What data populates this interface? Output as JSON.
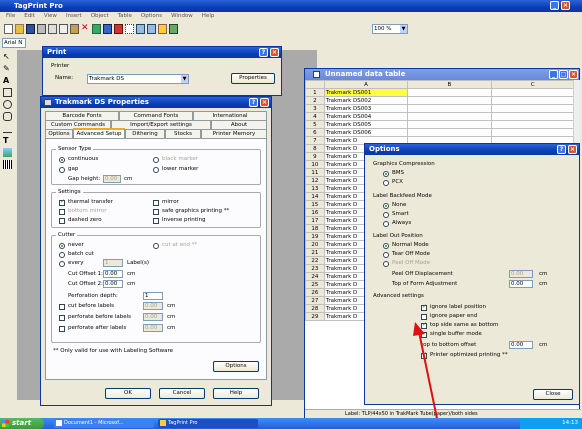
{
  "app": {
    "title": "TagPrint Pro",
    "menu": [
      "File",
      "Edit",
      "View",
      "Insert",
      "Object",
      "Table",
      "Options",
      "Window",
      "Help"
    ],
    "zoom": "100 %",
    "font": "Arial N",
    "tools_left": [
      "select-icon",
      "pencil-icon",
      "text-tool-icon",
      "rectangle-icon",
      "ellipse-icon",
      "rounded-rect-icon",
      "line-icon",
      "text-icon",
      "image-icon",
      "barcode-icon"
    ]
  },
  "print_dialog": {
    "title": "Print",
    "printer_label": "Printer",
    "name_label": "Name:",
    "name_value": "Trakmark DS",
    "properties_button": "Properties"
  },
  "props_dialog": {
    "title": "Trakmark DS Properties",
    "tabs_row1": [
      "Barcode Fonts",
      "Command Fonts",
      "International"
    ],
    "tabs_row2": [
      "Custom Commands",
      "Import/Export settings",
      "About"
    ],
    "tabs_row3": [
      "Options",
      "Advanced Setup",
      "Dithering",
      "Stocks",
      "Printer Memory"
    ],
    "sensor_type": {
      "label": "Sensor Type",
      "continuous": "continuous",
      "gap": "gap",
      "gap_height_label": "Gap height:",
      "gap_height_value": "0.00",
      "gap_height_unit": "cm",
      "black_marker": "black marker",
      "lower_marker": "lower marker"
    },
    "settings": {
      "label": "Settings",
      "thermal_transfer": "thermal transfer",
      "mirror": "mirror",
      "bottom_mirror": "bottom mirror",
      "safe_graphics": "safe graphics printing **",
      "dashed_zero": "dashed zero",
      "inverse_printing": "Inverse printing"
    },
    "cutter": {
      "label": "Cutter",
      "never": "never",
      "cut_at_end": "cut at end **",
      "batch_cut": "batch cut",
      "every": "every",
      "every_value": "1",
      "labels": "Label(s)",
      "cut_offset1_label": "Cut Offset 1:",
      "cut_offset1_value": "0.00",
      "cut_offset2_label": "Cut Offset 2:",
      "cut_offset2_value": "0.00",
      "unit": "cm",
      "perforation_depth_label": "Perforation depth:",
      "perforation_depth_value": "1",
      "cut_before": "cut before labels",
      "perforate_before": "perforate before labels",
      "perforate_after": "perforate after labels",
      "zero": "0.00"
    },
    "note": "** Only valid for use with Labeling Software",
    "options_button": "Options",
    "ok": "OK",
    "cancel": "Cancel",
    "help": "Help"
  },
  "data_table": {
    "title": "Unnamed data table",
    "columns": [
      "A",
      "B",
      "C"
    ],
    "rows": [
      {
        "n": "1",
        "a": "Trakmark DS001"
      },
      {
        "n": "2",
        "a": "Trakmark DS002"
      },
      {
        "n": "3",
        "a": "Trakmark DS003"
      },
      {
        "n": "4",
        "a": "Trakmark DS004"
      },
      {
        "n": "5",
        "a": "Trakmark DS005"
      },
      {
        "n": "6",
        "a": "Trakmark DS006"
      },
      {
        "n": "7",
        "a": "Trakmark D"
      },
      {
        "n": "8",
        "a": "Trakmark D"
      },
      {
        "n": "9",
        "a": "Trakmark D"
      },
      {
        "n": "10",
        "a": "Trakmark D"
      },
      {
        "n": "11",
        "a": "Trakmark D"
      },
      {
        "n": "12",
        "a": "Trakmark D"
      },
      {
        "n": "13",
        "a": "Trakmark D"
      },
      {
        "n": "14",
        "a": "Trakmark D"
      },
      {
        "n": "15",
        "a": "Trakmark D"
      },
      {
        "n": "16",
        "a": "Trakmark D"
      },
      {
        "n": "17",
        "a": "Trakmark D"
      },
      {
        "n": "18",
        "a": "Trakmark D"
      },
      {
        "n": "19",
        "a": "Trakmark D"
      },
      {
        "n": "20",
        "a": "Trakmark D"
      },
      {
        "n": "21",
        "a": "Trakmark D"
      },
      {
        "n": "22",
        "a": "Trakmark D"
      },
      {
        "n": "23",
        "a": "Trakmark D"
      },
      {
        "n": "24",
        "a": "Trakmark D"
      },
      {
        "n": "25",
        "a": "Trakmark D"
      },
      {
        "n": "26",
        "a": "Trakmark D"
      },
      {
        "n": "27",
        "a": "Trakmark D"
      },
      {
        "n": "28",
        "a": "Trakmark D"
      },
      {
        "n": "29",
        "a": "Trakmark D"
      }
    ],
    "status": "Label: TLP/44x50 in TrakMark Tube(paper)/both sides"
  },
  "options_dialog": {
    "title": "Options",
    "graphics_compression": "Graphics Compression",
    "bms": "BMS",
    "pcx": "PCX",
    "label_backfeed": "Label Backfeed Mode",
    "none": "None",
    "smart": "Smart",
    "always": "Always",
    "label_out_position": "Label Out Position",
    "normal_mode": "Normal Mode",
    "tear_off_mode": "Tear Off Mode",
    "peel_off_mode": "Peel Off Mode",
    "peel_off_displacement": "Peel Off Displacement",
    "peel_off_value": "0.00",
    "top_of_form": "Top of Form Adjustment",
    "top_of_form_value": "0.00",
    "cm": "cm",
    "advanced": "Advanced settings",
    "ignore_label_position": "ignore label position",
    "ignore_paper_end": "ignore paper end",
    "top_side_same": "top side same as bottom",
    "single_buffer": "single buffer mode",
    "top_bottom_offset": "top to bottom offset",
    "top_bottom_value": "0.00",
    "optimized_printing": "Printer optimized printing **",
    "close": "Close"
  },
  "taskbar": {
    "start": "start",
    "task1": "Document1 - Microsof...",
    "task2": "TagPrint Pro",
    "clock": "14:13"
  },
  "colors": {
    "accent": "#0a3fb8",
    "highlight": "#ffff40",
    "arrow": "#e01010",
    "taskbar": "#245edb",
    "start": "#3a9a3a"
  }
}
